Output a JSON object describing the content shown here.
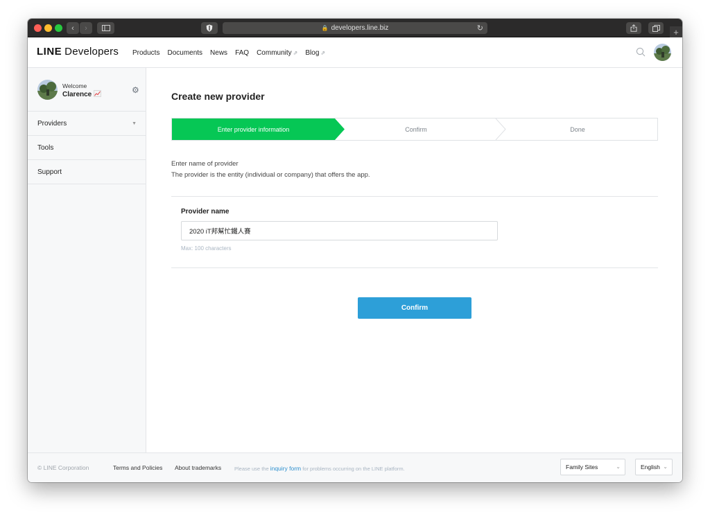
{
  "browser": {
    "url": "developers.line.biz",
    "new_tab_symbol": "+"
  },
  "header": {
    "logo_line": "LINE",
    "logo_developers": "Developers",
    "nav": [
      "Products",
      "Documents",
      "News",
      "FAQ",
      "Community",
      "Blog"
    ]
  },
  "sidebar": {
    "welcome": "Welcome",
    "username": "Clarence",
    "items": [
      {
        "label": "Providers"
      },
      {
        "label": "Tools"
      },
      {
        "label": "Support"
      }
    ]
  },
  "main": {
    "title": "Create new provider",
    "steps": [
      "Enter provider information",
      "Confirm",
      "Done"
    ],
    "active_step": 0,
    "description_line1": "Enter name of provider",
    "description_line2": "The provider is the entity (individual or company) that offers the app.",
    "field_label": "Provider name",
    "field_value": "2020 iT邦幫忙鐵人賽",
    "field_hint": "Max: 100 characters",
    "confirm_label": "Confirm"
  },
  "footer": {
    "copyright": "© LINE Corporation",
    "terms": "Terms and Policies",
    "trademarks": "About trademarks",
    "note_before": "Please use the ",
    "inquiry_link": "inquiry form",
    "note_after": " for problems occurring on the LINE platform.",
    "family_sites": "Family Sites",
    "language": "English"
  },
  "colors": {
    "active_step": "#06c755",
    "primary_button": "#2d9fd8",
    "link": "#2d8fce"
  }
}
